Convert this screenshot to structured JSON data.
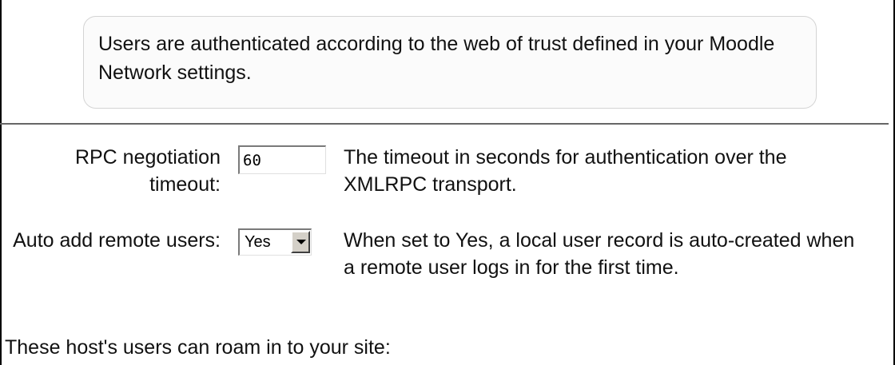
{
  "header": {
    "info_text": "Users are authenticated according to the web of trust defined in your Moodle Network settings."
  },
  "settings": [
    {
      "label": "RPC negotiation timeout:",
      "input_value": "60",
      "description": "The timeout in seconds for authentication over the XMLRPC transport."
    },
    {
      "label": "Auto add remote users:",
      "select_value": "Yes",
      "description": "When set to Yes, a local user record is auto-created when a remote user logs in for the first time."
    }
  ],
  "footer": {
    "roam_in_text": "These host's users can roam in to your site:"
  }
}
